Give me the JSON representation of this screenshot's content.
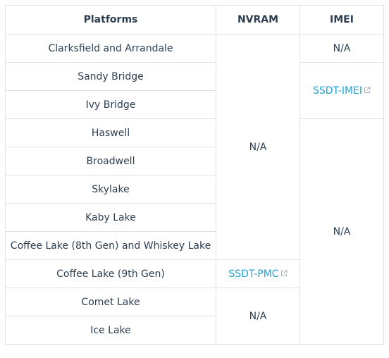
{
  "headers": [
    "Platforms",
    "NVRAM",
    "IMEI"
  ],
  "platforms": [
    "Clarksfield and Arrandale",
    "Sandy Bridge",
    "Ivy Bridge",
    "Haswell",
    "Broadwell",
    "Skylake",
    "Kaby Lake",
    "Coffee Lake (8th Gen) and Whiskey Lake",
    "Coffee Lake (9th Gen)",
    "Comet Lake",
    "Ice Lake"
  ],
  "nvram": {
    "group1": "N/A",
    "coffee_9th": "SSDT-PMC",
    "group2": "N/A"
  },
  "imei": {
    "clarksfield": "N/A",
    "sandy_ivy": "SSDT-IMEI",
    "rest": "N/A"
  },
  "colors": {
    "link": "#1ea0d8",
    "border": "#dfe2e5",
    "text": "#2c3e50"
  },
  "icons": {
    "external": "external-link-icon"
  }
}
